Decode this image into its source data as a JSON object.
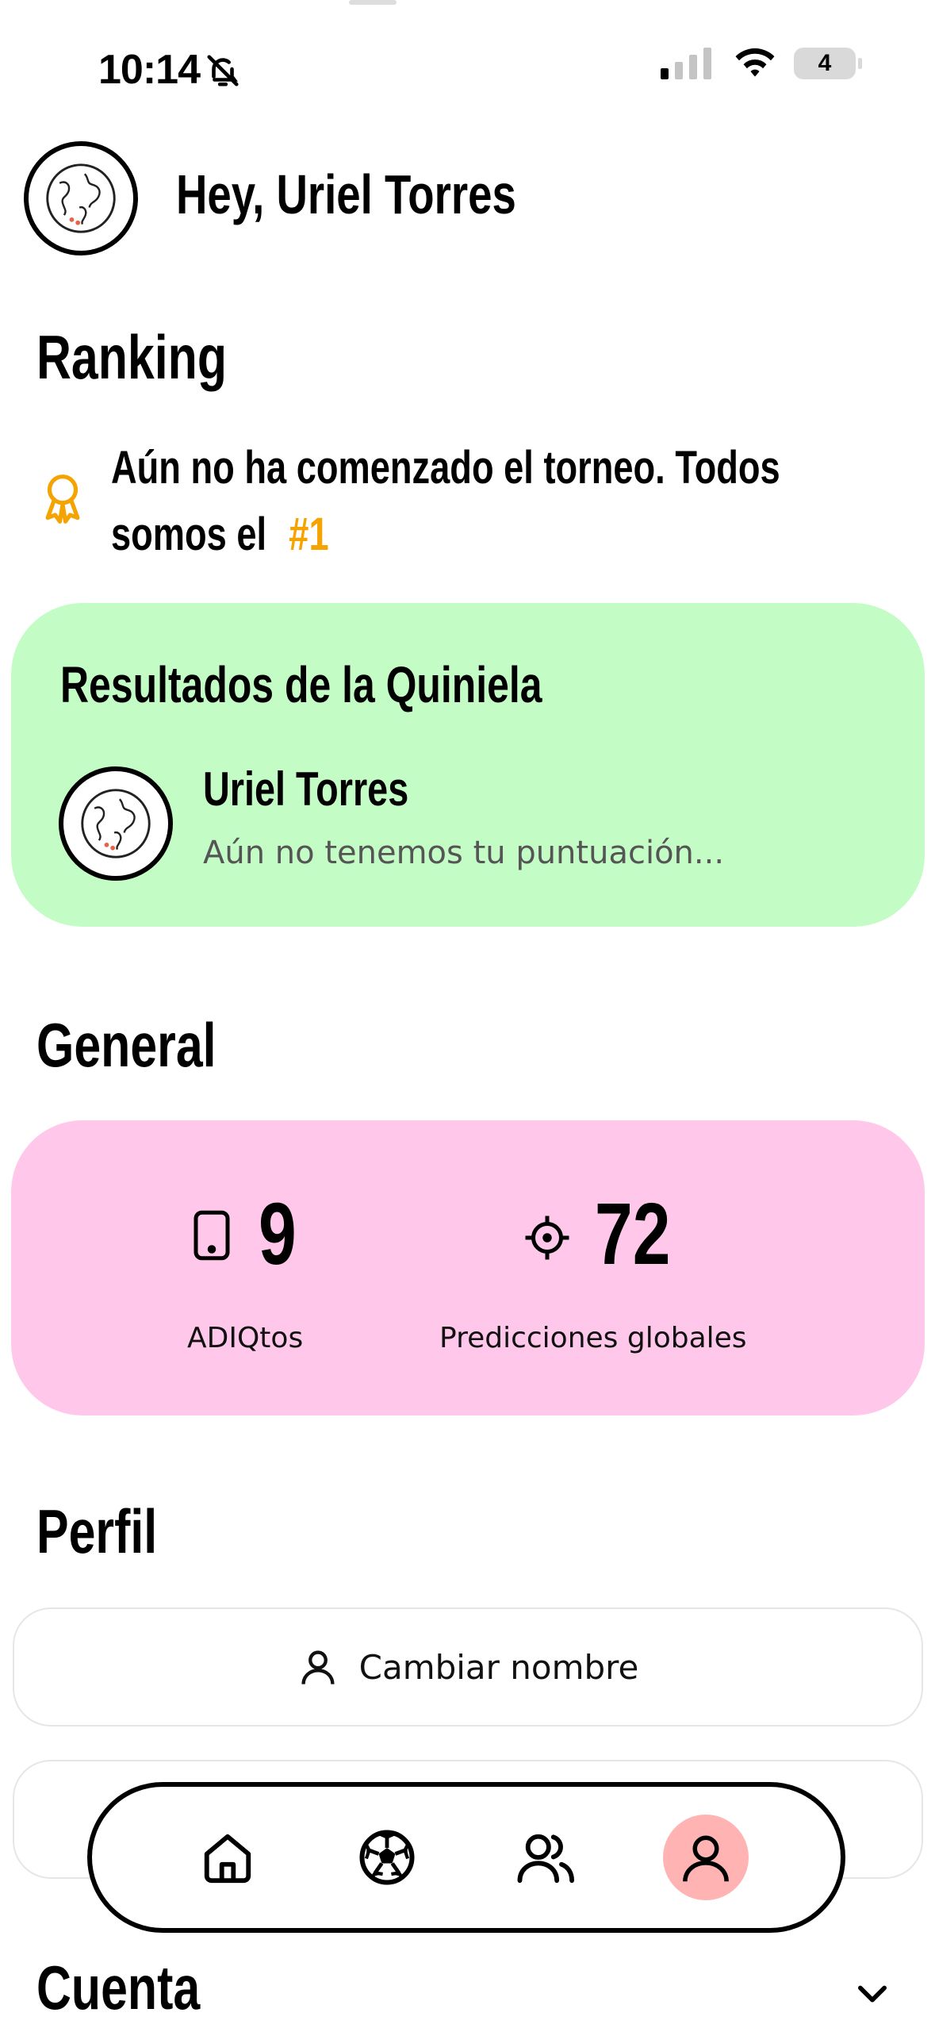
{
  "status_bar": {
    "time": "10:14",
    "battery": "4"
  },
  "header": {
    "greeting": "Hey, Uriel Torres"
  },
  "ranking": {
    "title": "Ranking",
    "message": "Aún no ha comenzado el torneo. Todos somos el",
    "rank": "#1"
  },
  "results": {
    "title": "Resultados de la Quiniela",
    "user_name": "Uriel Torres",
    "user_status": "Aún no tenemos tu puntuación..."
  },
  "general": {
    "title": "General",
    "stats": [
      {
        "value": "9",
        "label": "ADIQtos",
        "icon": "phone-icon"
      },
      {
        "value": "72",
        "label": "Predicciones globales",
        "icon": "crosshair-icon"
      }
    ]
  },
  "profile": {
    "title": "Perfil",
    "change_name_label": "Cambiar nombre"
  },
  "account": {
    "title": "Cuenta"
  },
  "nav": {
    "items": [
      "home",
      "matches",
      "groups",
      "profile"
    ],
    "active": "profile"
  },
  "colors": {
    "accent": "#f5a300",
    "green_card": "#c4fcc6",
    "pink_card": "#ffc8eb",
    "nav_active": "#ffb3b3"
  }
}
